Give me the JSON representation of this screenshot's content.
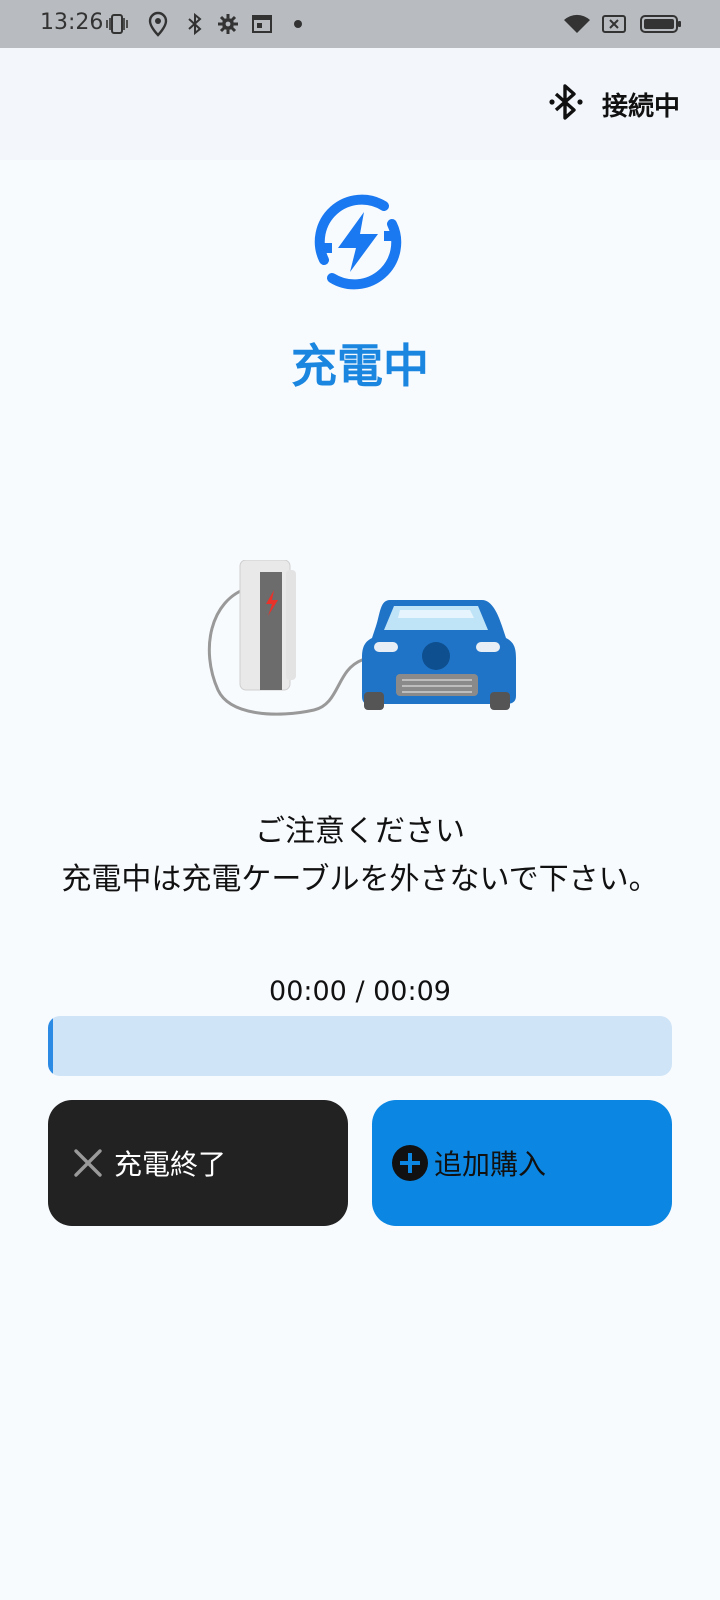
{
  "status_bar": {
    "time": "13:26",
    "icons": [
      "vibrate-icon",
      "location-icon",
      "bluetooth-icon",
      "settings-icon",
      "calendar-icon",
      "dot-icon",
      "wifi-icon",
      "no-sim-icon",
      "battery-icon"
    ]
  },
  "header": {
    "bluetooth_status": "接続中",
    "bluetooth_icon": "bluetooth-icon"
  },
  "main": {
    "logo_icon": "charging-bolt-icon",
    "title": "充電中",
    "illustration": "ev-charging-illustration",
    "notice_line1": "ご注意ください",
    "notice_line2": "充電中は充電ケーブルを外さないで下さい。",
    "timer": "00:00 / 00:09",
    "progress_fraction": 0.0
  },
  "actions": {
    "end_label": "充電終了",
    "end_icon": "close-icon",
    "add_label": "追加購入",
    "add_icon": "plus-circle-icon"
  },
  "colors": {
    "accent": "#1a86e0",
    "primary_button": "#0b87e3",
    "dark_button": "#222222",
    "progress_track": "#cfe4f7",
    "progress_fill": "#2b8ae3"
  }
}
